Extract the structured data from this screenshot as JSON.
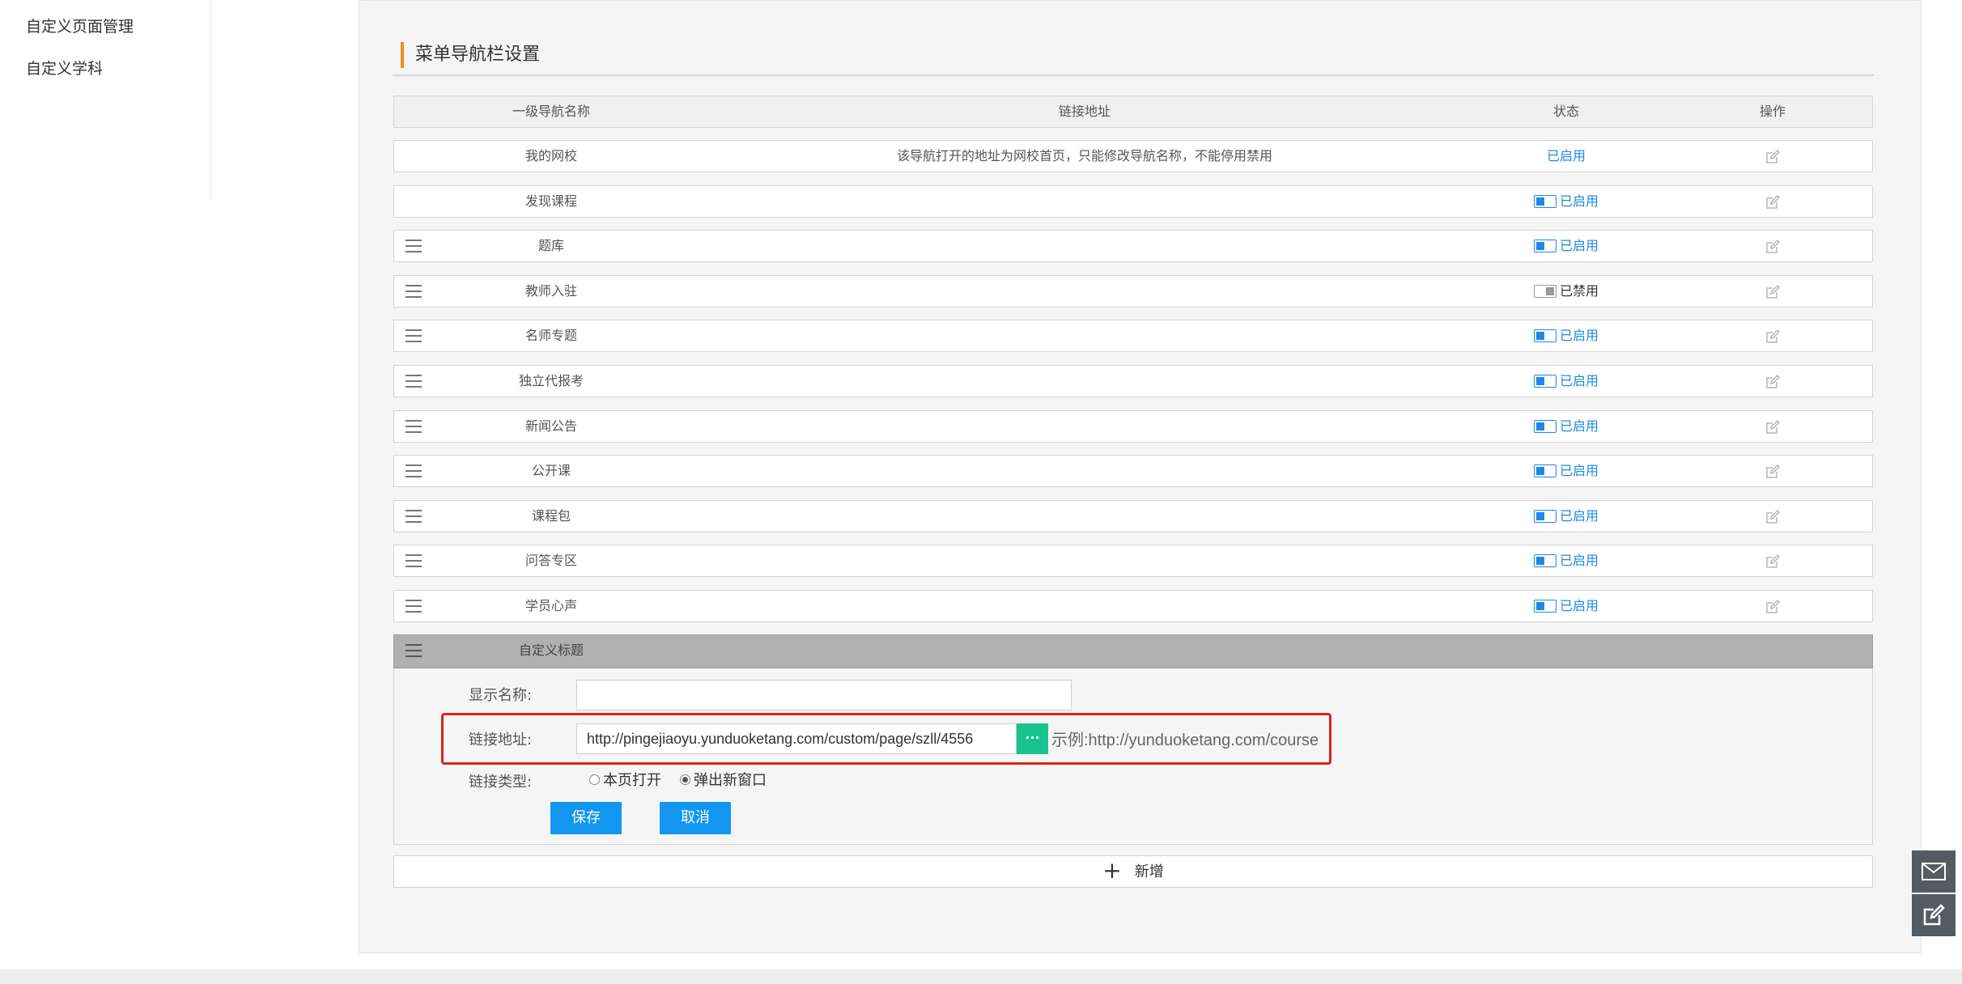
{
  "sidebar": {
    "items": [
      {
        "label": "自定义页面管理"
      },
      {
        "label": "自定义学科"
      }
    ]
  },
  "section": {
    "title": "菜单导航栏设置"
  },
  "table": {
    "headers": {
      "name": "一级导航名称",
      "url": "链接地址",
      "status": "状态",
      "op": "操作"
    },
    "rows": [
      {
        "name": "我的网校",
        "url": "该导航打开的地址为网校首页，只能修改导航名称，不能停用禁用",
        "status": "已启用",
        "state": "on",
        "toggle": false,
        "drag": false
      },
      {
        "name": "发现课程",
        "url": "",
        "status": "已启用",
        "state": "on",
        "toggle": true,
        "drag": false
      },
      {
        "name": "题库",
        "url": "",
        "status": "已启用",
        "state": "on",
        "toggle": true,
        "drag": true
      },
      {
        "name": "教师入驻",
        "url": "",
        "status": "已禁用",
        "state": "off",
        "toggle": true,
        "drag": true
      },
      {
        "name": "名师专题",
        "url": "",
        "status": "已启用",
        "state": "on",
        "toggle": true,
        "drag": true
      },
      {
        "name": "独立代报考",
        "url": "",
        "status": "已启用",
        "state": "on",
        "toggle": true,
        "drag": true
      },
      {
        "name": "新闻公告",
        "url": "",
        "status": "已启用",
        "state": "on",
        "toggle": true,
        "drag": true
      },
      {
        "name": "公开课",
        "url": "",
        "status": "已启用",
        "state": "on",
        "toggle": true,
        "drag": true
      },
      {
        "name": "课程包",
        "url": "",
        "status": "已启用",
        "state": "on",
        "toggle": true,
        "drag": true
      },
      {
        "name": "问答专区",
        "url": "",
        "status": "已启用",
        "state": "on",
        "toggle": true,
        "drag": true
      },
      {
        "name": "学员心声",
        "url": "",
        "status": "已启用",
        "state": "on",
        "toggle": true,
        "drag": true
      }
    ]
  },
  "custom": {
    "name": "自定义标题",
    "form": {
      "display_name_label": "显示名称:",
      "display_name_value": "",
      "link_label": "链接地址:",
      "link_value": "http://pingejiaoyu.yunduoketang.com/custom/page/szll/4556",
      "browse_label": "···",
      "example": "示例:http://yunduoketang.com/course",
      "type_label": "链接类型:",
      "type_options": [
        {
          "label": "本页打开",
          "checked": false
        },
        {
          "label": "弹出新窗口",
          "checked": true
        }
      ],
      "save_label": "保存",
      "cancel_label": "取消"
    }
  },
  "add": {
    "plus": "+",
    "label": "新增"
  },
  "floating": [
    {
      "icon": "mail-icon"
    },
    {
      "icon": "edit-note-icon"
    }
  ],
  "colors": {
    "accent": "#1296f0",
    "enabled_text": "#1e88e5",
    "browse_button": "#19c38e",
    "highlight": "#e02020",
    "title_bar": "#f08a24"
  }
}
